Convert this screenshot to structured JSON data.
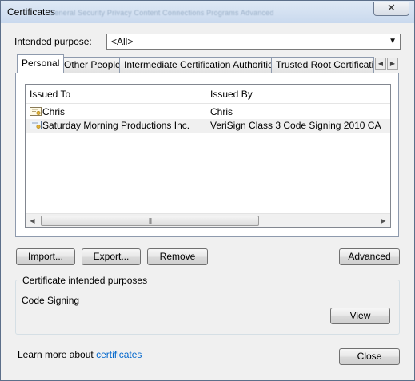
{
  "window": {
    "title": "Certificates",
    "background_tabs_ghost": "General   Security   Privacy   Content   Connections   Programs   Advanced",
    "close_glyph": "✕"
  },
  "intended_purpose": {
    "label": "Intended purpose:",
    "selected": "<All>"
  },
  "tabs": [
    {
      "label": "Personal",
      "active": true
    },
    {
      "label": "Other People",
      "active": false
    },
    {
      "label": "Intermediate Certification Authorities",
      "active": false
    },
    {
      "label": "Trusted Root Certification",
      "active": false
    }
  ],
  "tab_scroll": {
    "left": "◀",
    "right": "▶"
  },
  "list": {
    "columns": [
      "Issued To",
      "Issued By"
    ],
    "rows": [
      {
        "issued_to": "Chris",
        "issued_by": "Chris",
        "icon": "certificate-icon"
      },
      {
        "issued_to": "Saturday Morning Productions Inc.",
        "issued_by": "VeriSign Class 3 Code Signing 2010 CA",
        "icon": "certificate-icon"
      }
    ],
    "scroll_left": "◀",
    "scroll_right": "▶",
    "thumb_grip": "|||"
  },
  "buttons": {
    "import": "Import...",
    "export": "Export...",
    "remove": "Remove",
    "advanced": "Advanced",
    "view": "View",
    "close": "Close"
  },
  "intended_purposes": {
    "title": "Certificate intended purposes",
    "value": "Code Signing"
  },
  "footer": {
    "text": "Learn more about ",
    "link": "certificates"
  },
  "colors": {
    "link": "#0066cc",
    "selected_row": "#f0f0f0",
    "window_bg": "#f0f0f0"
  }
}
